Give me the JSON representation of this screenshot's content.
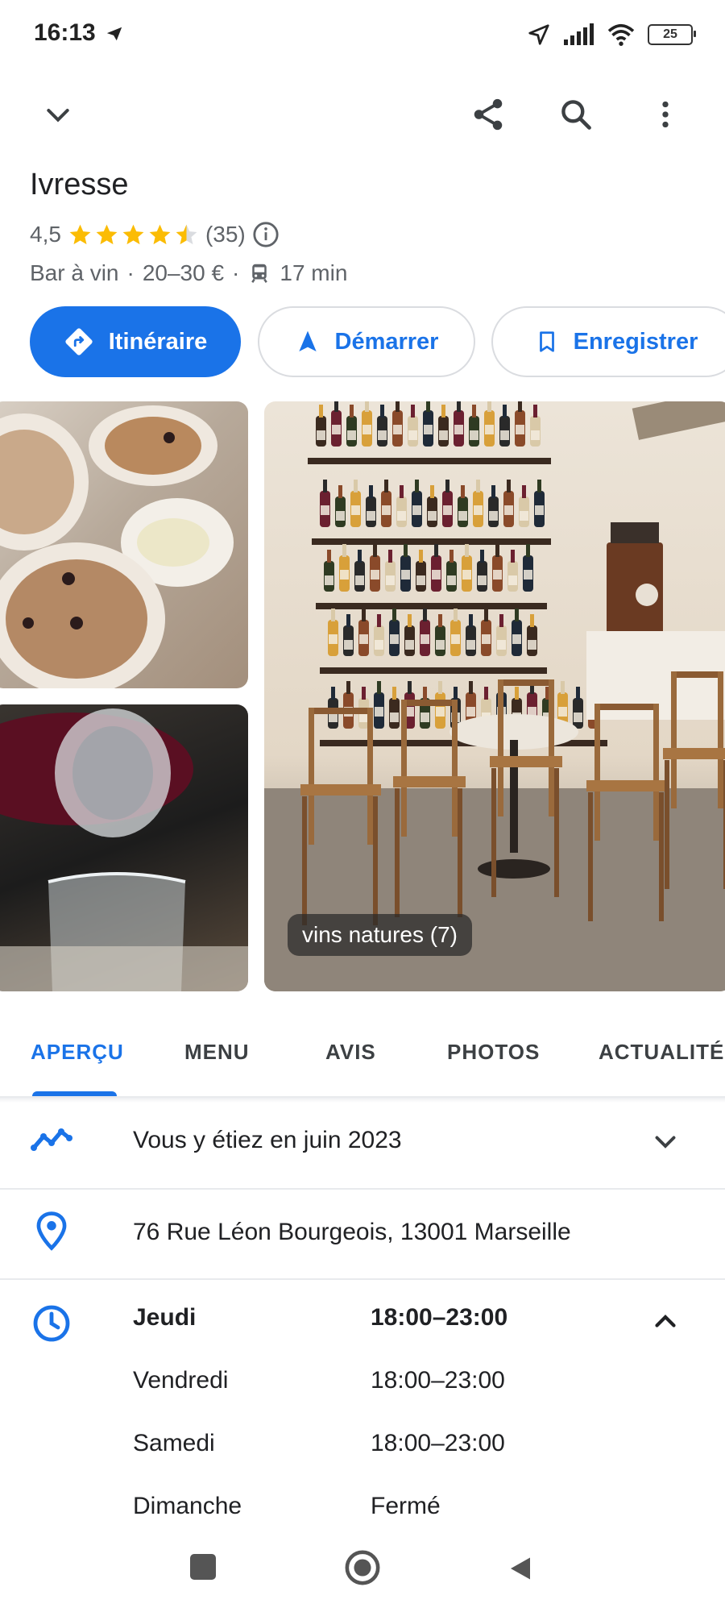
{
  "status_bar": {
    "time": "16:13",
    "battery": "25"
  },
  "place": {
    "name": "Ivresse",
    "rating": "4,5",
    "rating_value": 4.5,
    "reviews_count": "(35)",
    "category": "Bar à vin",
    "price": "20–30 €",
    "transit_time": "17 min"
  },
  "actions": {
    "directions": "Itinéraire",
    "start": "Démarrer",
    "save": "Enregistrer"
  },
  "photos": {
    "caption": "vins natures (7)"
  },
  "tabs": [
    {
      "label": "APERÇU"
    },
    {
      "label": "MENU"
    },
    {
      "label": "AVIS"
    },
    {
      "label": "PHOTOS"
    },
    {
      "label": "ACTUALITÉ"
    }
  ],
  "visit": {
    "text": "Vous y étiez en juin 2023"
  },
  "address": {
    "text": "76 Rue Léon Bourgeois, 13001 Marseille"
  },
  "hours": [
    {
      "day": "Jeudi",
      "time": "18:00–23:00"
    },
    {
      "day": "Vendredi",
      "time": "18:00–23:00"
    },
    {
      "day": "Samedi",
      "time": "18:00–23:00"
    },
    {
      "day": "Dimanche",
      "time": "Fermé"
    }
  ],
  "colors": {
    "accent": "#1a73e8",
    "star": "#fbbc04",
    "text": "#202124",
    "muted": "#5f6368"
  },
  "icons": {
    "top_left": "chevron-down-icon",
    "top_right": [
      "share-icon",
      "search-icon",
      "more-vert-icon"
    ],
    "visit": "timeline-icon",
    "address": "location-pin-icon",
    "hours": "clock-icon"
  }
}
